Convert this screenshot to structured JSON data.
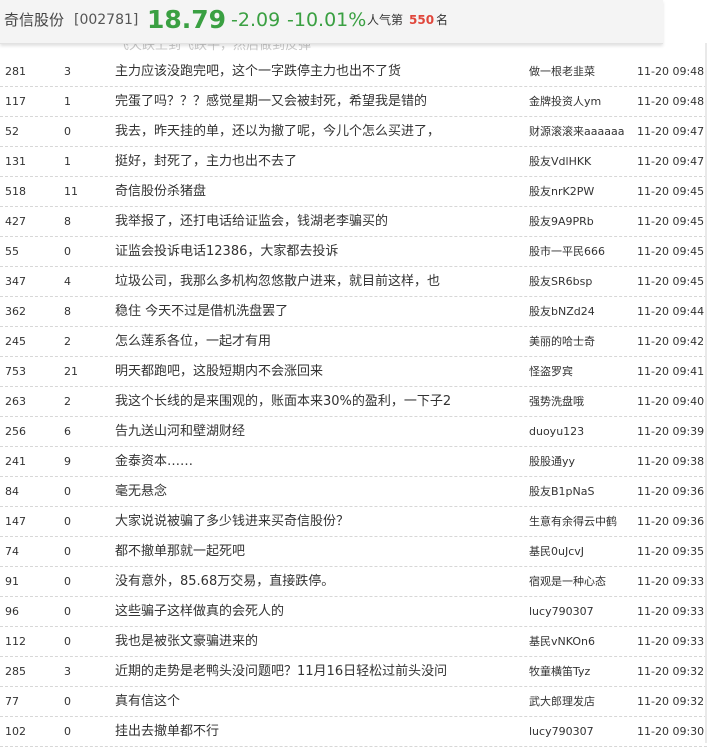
{
  "header": {
    "stock_name": "奇信股份",
    "stock_code": "[002781]",
    "price": "18.79",
    "change": "-2.09",
    "change_pct": "-10.01%",
    "popularity_label": "人气第",
    "popularity_rank": "550",
    "popularity_suffix": "名",
    "price_color": "#3aa042",
    "rank_color": "#e0473c"
  },
  "partially_hidden_row_text": "飞天跌上到飞跌平，然后做到反弹",
  "posts": [
    {
      "reads": "281",
      "replies": "3",
      "title": "主力应该没跑完吧，这个一字跌停主力也出不了货",
      "author": "做一根老韭菜",
      "time": "11-20 09:48"
    },
    {
      "reads": "117",
      "replies": "1",
      "title": "完蛋了吗？？？感觉星期一又会被封死，希望我是错的",
      "author": "金牌投资人ym",
      "time": "11-20 09:48"
    },
    {
      "reads": "52",
      "replies": "0",
      "title": "我去，昨天挂的单，还以为撤了呢，今儿个怎么买进了，",
      "author": "财源滚滚来aaaaaa",
      "time": "11-20 09:47"
    },
    {
      "reads": "131",
      "replies": "1",
      "title": "挺好，封死了，主力也出不去了",
      "author": "股友VdlHKK",
      "time": "11-20 09:47"
    },
    {
      "reads": "518",
      "replies": "11",
      "title": "奇信股份杀猪盘",
      "author": "股友nrK2PW",
      "time": "11-20 09:45"
    },
    {
      "reads": "427",
      "replies": "8",
      "title": "我举报了，还打电话给证监会，钱湖老李骗买的",
      "author": "股友9A9PRb",
      "time": "11-20 09:45"
    },
    {
      "reads": "55",
      "replies": "0",
      "title": "证监会投诉电话12386，大家都去投诉",
      "author": "股市一平民666",
      "time": "11-20 09:45"
    },
    {
      "reads": "347",
      "replies": "4",
      "title": "垃圾公司，我那么多机构忽悠散户进来，就目前这样，也",
      "author": "股友SR6bsp",
      "time": "11-20 09:45"
    },
    {
      "reads": "362",
      "replies": "8",
      "title": "稳住 今天不过是借机洗盘罢了",
      "author": "股友bNZd24",
      "time": "11-20 09:44"
    },
    {
      "reads": "245",
      "replies": "2",
      "title": "怎么莲系各位，一起才有用",
      "author": "美丽的哈士奇",
      "time": "11-20 09:42"
    },
    {
      "reads": "753",
      "replies": "21",
      "title": "明天都跑吧，这股短期内不会涨回来",
      "author": "怪盗罗宾",
      "time": "11-20 09:41"
    },
    {
      "reads": "263",
      "replies": "2",
      "title": "我这个长线的是来围观的，账面本来30%的盈利，一下子2",
      "author": "强势洗盘哦",
      "time": "11-20 09:40"
    },
    {
      "reads": "256",
      "replies": "6",
      "title": "告九送山河和壁湖财经",
      "author": "duoyu123",
      "time": "11-20 09:39"
    },
    {
      "reads": "241",
      "replies": "9",
      "title": "金泰资本……",
      "author": "股股通yy",
      "time": "11-20 09:38"
    },
    {
      "reads": "84",
      "replies": "0",
      "title": "毫无悬念",
      "author": "股友B1pNaS",
      "time": "11-20 09:36"
    },
    {
      "reads": "147",
      "replies": "0",
      "title": "大家说说被骗了多少钱进来买奇信股份？",
      "author": "生意有余得云中鹤",
      "time": "11-20 09:36"
    },
    {
      "reads": "74",
      "replies": "0",
      "title": "都不撤单那就一起死吧",
      "author": "基民0uJcvJ",
      "time": "11-20 09:35"
    },
    {
      "reads": "91",
      "replies": "0",
      "title": "没有意外，85.68万交易，直接跌停。",
      "author": "宿观是一种心态",
      "time": "11-20 09:33"
    },
    {
      "reads": "96",
      "replies": "0",
      "title": "这些骗子这样做真的会死人的",
      "author": "lucy790307",
      "time": "11-20 09:33"
    },
    {
      "reads": "112",
      "replies": "0",
      "title": "我也是被张文豪骗进来的",
      "author": "基民vNKOn6",
      "time": "11-20 09:33"
    },
    {
      "reads": "285",
      "replies": "3",
      "title": "近期的走势是老鸭头没问题吧？11月16日轻松过前头没问",
      "author": "牧童横笛Tyz",
      "time": "11-20 09:32"
    },
    {
      "reads": "77",
      "replies": "0",
      "title": "真有信这个",
      "author": "武大郎理发店",
      "time": "11-20 09:32"
    },
    {
      "reads": "102",
      "replies": "0",
      "title": "挂出去撤单都不行",
      "author": "lucy790307",
      "time": "11-20 09:30"
    }
  ]
}
